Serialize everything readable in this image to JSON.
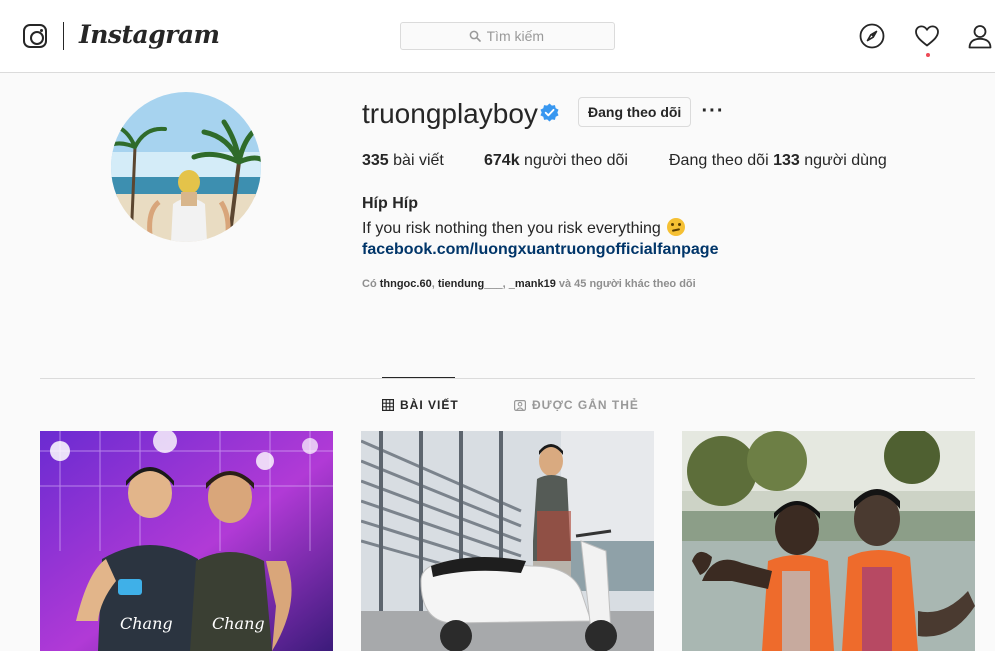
{
  "header": {
    "logo_text": "Instagram",
    "search": {
      "placeholder": "Tìm kiếm"
    },
    "nav_icons": [
      "compass-icon",
      "heart-icon",
      "user-icon"
    ]
  },
  "profile": {
    "username": "truongplayboy",
    "verified": true,
    "follow_button_label": "Đang theo dõi",
    "more_label": "···",
    "stats": {
      "posts_count": "335",
      "posts_label": " bài viết",
      "followers_count": "674k",
      "followers_label": " người theo dõi",
      "following_prefix": "Đang theo dõi ",
      "following_count": "133",
      "following_suffix": " người dùng"
    },
    "bio": {
      "name": "Híp Híp",
      "text": "If you risk nothing then you risk everything",
      "link": "facebook.com/luongxuantruongofficialfanpage"
    },
    "followed_by": {
      "prefix": "Có ",
      "users": [
        "thngoc.60",
        "tiendung___",
        "_mank19"
      ],
      "sep1": ", ",
      "sep2": ", ",
      "suffix": " và 45 người khác theo dõi"
    }
  },
  "tabs": [
    {
      "label": "BÀI VIẾT",
      "icon": "grid-icon",
      "active": true
    },
    {
      "label": "ĐƯỢC GẮN THẺ",
      "icon": "tagged-icon",
      "active": false
    }
  ],
  "posts": [
    {
      "id": "post-1",
      "jersey_text": "Chang"
    },
    {
      "id": "post-2"
    },
    {
      "id": "post-3"
    }
  ],
  "colors": {
    "link": "#003569",
    "verified": "#3897f0",
    "notification_dot": "#ed4956",
    "border": "#dbdbdb"
  }
}
